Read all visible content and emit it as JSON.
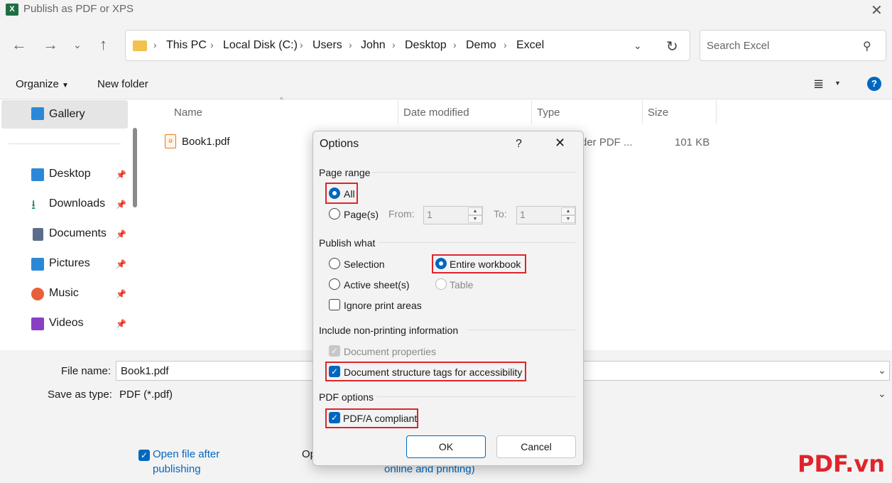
{
  "window": {
    "title": "Publish as PDF or XPS",
    "app_icon": "X"
  },
  "nav": {
    "breadcrumbs": [
      "This PC",
      "Local Disk (C:)",
      "Users",
      "John",
      "Desktop",
      "Demo",
      "Excel"
    ],
    "search_placeholder": "Search Excel"
  },
  "toolbar": {
    "organize": "Organize",
    "new_folder": "New folder"
  },
  "sidebar": {
    "gallery": "Gallery",
    "items": [
      {
        "label": "Desktop",
        "icon": "desktop-icon",
        "color": "#2b88d8"
      },
      {
        "label": "Downloads",
        "icon": "download-icon",
        "color": "#1a8f5a"
      },
      {
        "label": "Documents",
        "icon": "document-icon",
        "color": "#5b6d8a"
      },
      {
        "label": "Pictures",
        "icon": "pictures-icon",
        "color": "#2b88d8"
      },
      {
        "label": "Music",
        "icon": "music-icon",
        "color": "#e8603a"
      },
      {
        "label": "Videos",
        "icon": "videos-icon",
        "color": "#8a3fc4"
      }
    ]
  },
  "files": {
    "columns": [
      "Name",
      "Date modified",
      "Type",
      "Size"
    ],
    "rows": [
      {
        "name": "Book1.pdf",
        "type": "der PDF ...",
        "size": "101 KB"
      }
    ]
  },
  "bottom": {
    "file_name_label": "File name:",
    "file_name": "Book1.pdf",
    "save_type_label": "Save as type:",
    "save_type": "PDF (*.pdf)",
    "open_after_line1": "Open file after",
    "open_after_line2": "publishing",
    "partial_left": "Op",
    "partial_right": "online and printing)"
  },
  "dialog": {
    "title": "Options",
    "help": "?",
    "page_range": {
      "heading": "Page range",
      "all": "All",
      "pages": "Page(s)",
      "from_label": "From:",
      "from_value": "1",
      "to_label": "To:",
      "to_value": "1"
    },
    "publish_what": {
      "heading": "Publish what",
      "selection": "Selection",
      "entire_workbook": "Entire workbook",
      "active_sheets": "Active sheet(s)",
      "table": "Table",
      "ignore_print_areas": "Ignore print areas"
    },
    "non_printing": {
      "heading": "Include non-printing information",
      "doc_properties": "Document properties",
      "doc_structure": "Document structure tags for accessibility"
    },
    "pdf_options": {
      "heading": "PDF options",
      "pdfa": "PDF/A compliant"
    },
    "ok": "OK",
    "cancel": "Cancel"
  },
  "watermark": "PDF.vn"
}
